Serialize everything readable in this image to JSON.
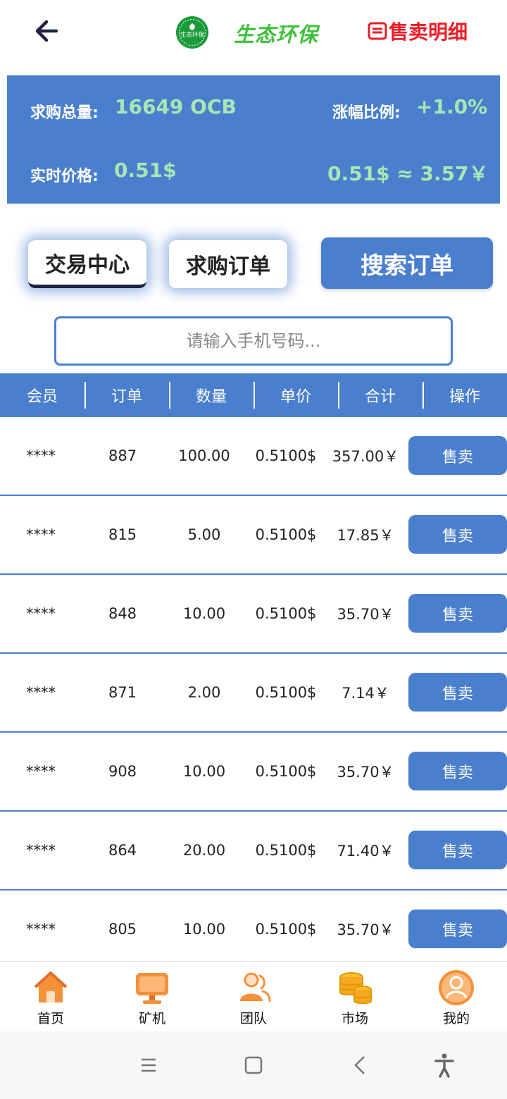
{
  "header": {
    "logo_text": "生态环保",
    "brand": "生态环保",
    "sale_detail_label": "售卖明细"
  },
  "summary": {
    "total_label": "求购总量:",
    "total_value": "16649 OCB",
    "rise_label": "涨幅比例:",
    "rise_value": "+1.0%",
    "price_label": "实时价格:",
    "price_value": "0.51$",
    "conversion": "0.51$ ≈ 3.57￥"
  },
  "tabs": [
    {
      "label": "交易中心",
      "active": true
    },
    {
      "label": "求购订单",
      "active": false
    }
  ],
  "search_button": "搜索订单",
  "search": {
    "placeholder": "请输入手机号码...",
    "value": ""
  },
  "table": {
    "columns": [
      "会员",
      "订单",
      "数量",
      "单价",
      "合计",
      "操作"
    ],
    "action_label": "售卖",
    "rows": [
      {
        "member": "****",
        "order": "887",
        "qty": "100.00",
        "price": "0.5100$",
        "total": "357.00￥"
      },
      {
        "member": "****",
        "order": "815",
        "qty": "5.00",
        "price": "0.5100$",
        "total": "17.85￥"
      },
      {
        "member": "****",
        "order": "848",
        "qty": "10.00",
        "price": "0.5100$",
        "total": "35.70￥"
      },
      {
        "member": "****",
        "order": "871",
        "qty": "2.00",
        "price": "0.5100$",
        "total": "7.14￥"
      },
      {
        "member": "****",
        "order": "908",
        "qty": "10.00",
        "price": "0.5100$",
        "total": "35.70￥"
      },
      {
        "member": "****",
        "order": "864",
        "qty": "20.00",
        "price": "0.5100$",
        "total": "71.40￥"
      },
      {
        "member": "****",
        "order": "805",
        "qty": "10.00",
        "price": "0.5100$",
        "total": "35.70￥"
      }
    ]
  },
  "nav": [
    {
      "label": "首页",
      "icon": "home-icon"
    },
    {
      "label": "矿机",
      "icon": "monitor-icon"
    },
    {
      "label": "团队",
      "icon": "team-icon"
    },
    {
      "label": "市场",
      "icon": "coins-icon"
    },
    {
      "label": "我的",
      "icon": "profile-icon"
    }
  ],
  "system_bar": [
    "menu-icon",
    "home-square-icon",
    "back-chevron-icon",
    "accessibility-icon"
  ],
  "colors": {
    "primary": "#4a7fce",
    "brand_green": "#3ec13a",
    "value_green": "#a8e6b4",
    "sale_red": "#ee1c25",
    "nav_orange": "#f5903a"
  }
}
